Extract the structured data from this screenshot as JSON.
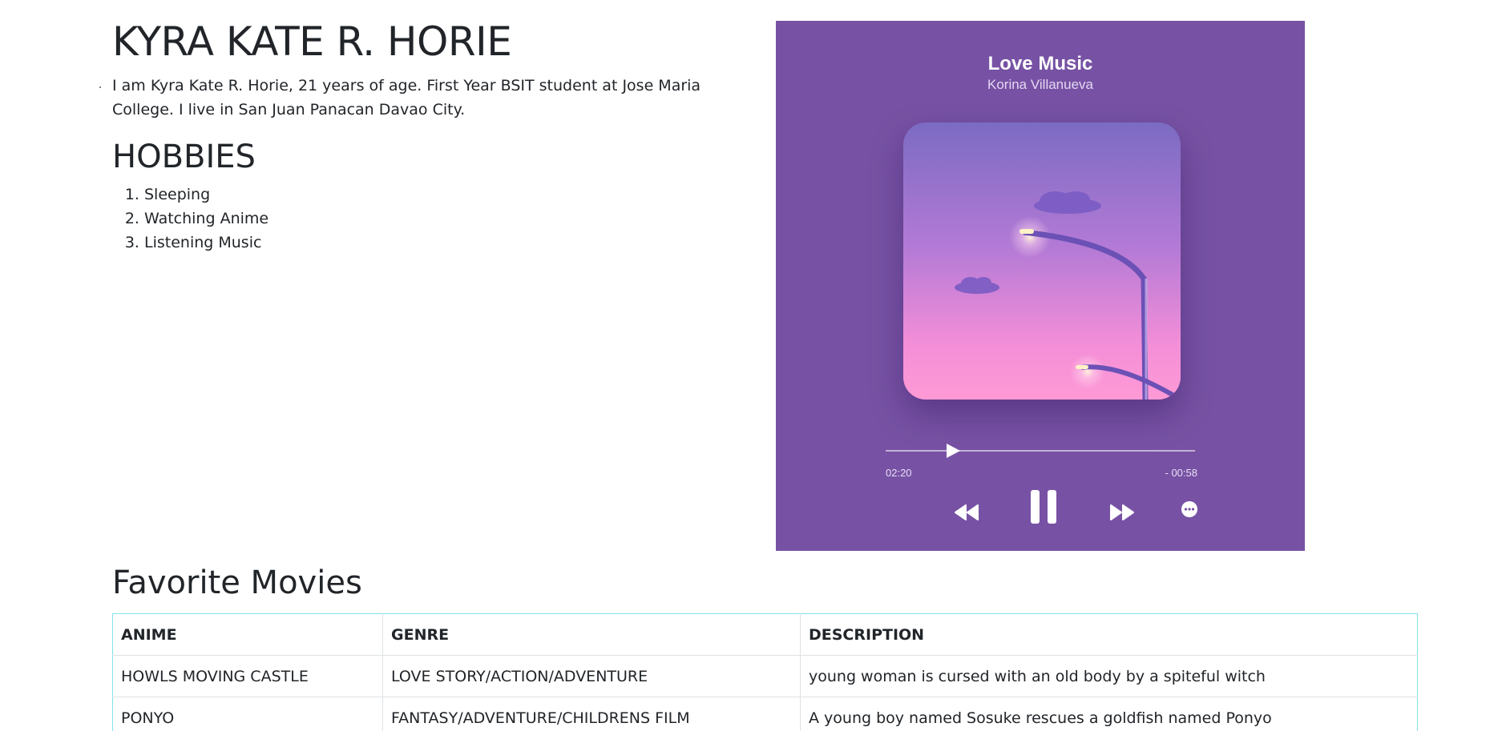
{
  "profile": {
    "name": "KYRA KATE R. HORIE",
    "bio": "I am Kyra Kate R. Horie, 21 years of age. First Year BSIT student at Jose Maria College. I live in San Juan Panacan Davao City."
  },
  "hobbies": {
    "title": "HOBBIES",
    "items": [
      "Sleeping",
      "Watching Anime",
      "Listening Music"
    ]
  },
  "player": {
    "song_title": "Love Music",
    "artist": "Korina Villanueva",
    "elapsed": "02:20",
    "remaining": "- 00:58",
    "background_color": "#7752a4",
    "progress_fraction": 0.2,
    "controls": [
      "rewind-icon",
      "pause-icon",
      "fast-forward-icon",
      "more-icon"
    ]
  },
  "movies": {
    "title": "Favorite Movies",
    "columns": [
      "ANIME",
      "GENRE",
      "DESCRIPTION"
    ],
    "rows": [
      [
        "HOWLS MOVING CASTLE",
        "LOVE STORY/ACTION/ADVENTURE",
        "young woman is cursed with an old body by a spiteful witch"
      ],
      [
        "PONYO",
        "FANTASY/ADVENTURE/CHILDRENS FILM",
        "A young boy named Sosuke rescues a goldfish named Ponyo"
      ]
    ]
  }
}
